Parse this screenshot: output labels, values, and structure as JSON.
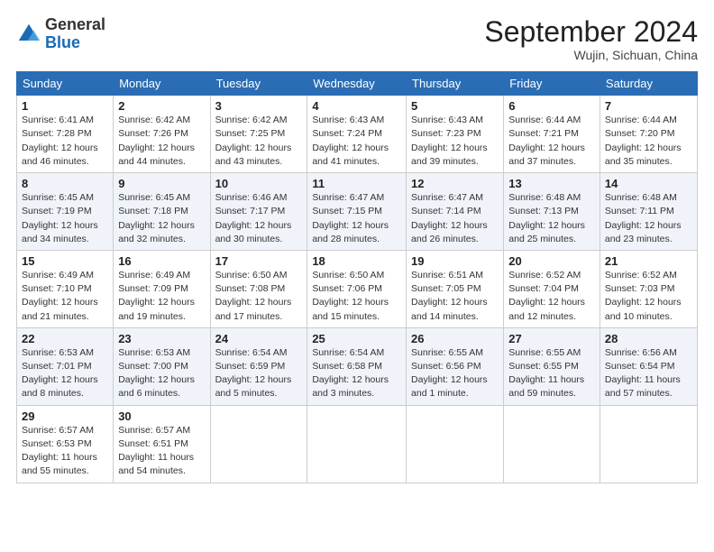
{
  "logo": {
    "general": "General",
    "blue": "Blue"
  },
  "header": {
    "month": "September 2024",
    "location": "Wujin, Sichuan, China"
  },
  "days_of_week": [
    "Sunday",
    "Monday",
    "Tuesday",
    "Wednesday",
    "Thursday",
    "Friday",
    "Saturday"
  ],
  "weeks": [
    [
      {
        "day": "1",
        "info": "Sunrise: 6:41 AM\nSunset: 7:28 PM\nDaylight: 12 hours\nand 46 minutes."
      },
      {
        "day": "2",
        "info": "Sunrise: 6:42 AM\nSunset: 7:26 PM\nDaylight: 12 hours\nand 44 minutes."
      },
      {
        "day": "3",
        "info": "Sunrise: 6:42 AM\nSunset: 7:25 PM\nDaylight: 12 hours\nand 43 minutes."
      },
      {
        "day": "4",
        "info": "Sunrise: 6:43 AM\nSunset: 7:24 PM\nDaylight: 12 hours\nand 41 minutes."
      },
      {
        "day": "5",
        "info": "Sunrise: 6:43 AM\nSunset: 7:23 PM\nDaylight: 12 hours\nand 39 minutes."
      },
      {
        "day": "6",
        "info": "Sunrise: 6:44 AM\nSunset: 7:21 PM\nDaylight: 12 hours\nand 37 minutes."
      },
      {
        "day": "7",
        "info": "Sunrise: 6:44 AM\nSunset: 7:20 PM\nDaylight: 12 hours\nand 35 minutes."
      }
    ],
    [
      {
        "day": "8",
        "info": "Sunrise: 6:45 AM\nSunset: 7:19 PM\nDaylight: 12 hours\nand 34 minutes."
      },
      {
        "day": "9",
        "info": "Sunrise: 6:45 AM\nSunset: 7:18 PM\nDaylight: 12 hours\nand 32 minutes."
      },
      {
        "day": "10",
        "info": "Sunrise: 6:46 AM\nSunset: 7:17 PM\nDaylight: 12 hours\nand 30 minutes."
      },
      {
        "day": "11",
        "info": "Sunrise: 6:47 AM\nSunset: 7:15 PM\nDaylight: 12 hours\nand 28 minutes."
      },
      {
        "day": "12",
        "info": "Sunrise: 6:47 AM\nSunset: 7:14 PM\nDaylight: 12 hours\nand 26 minutes."
      },
      {
        "day": "13",
        "info": "Sunrise: 6:48 AM\nSunset: 7:13 PM\nDaylight: 12 hours\nand 25 minutes."
      },
      {
        "day": "14",
        "info": "Sunrise: 6:48 AM\nSunset: 7:11 PM\nDaylight: 12 hours\nand 23 minutes."
      }
    ],
    [
      {
        "day": "15",
        "info": "Sunrise: 6:49 AM\nSunset: 7:10 PM\nDaylight: 12 hours\nand 21 minutes."
      },
      {
        "day": "16",
        "info": "Sunrise: 6:49 AM\nSunset: 7:09 PM\nDaylight: 12 hours\nand 19 minutes."
      },
      {
        "day": "17",
        "info": "Sunrise: 6:50 AM\nSunset: 7:08 PM\nDaylight: 12 hours\nand 17 minutes."
      },
      {
        "day": "18",
        "info": "Sunrise: 6:50 AM\nSunset: 7:06 PM\nDaylight: 12 hours\nand 15 minutes."
      },
      {
        "day": "19",
        "info": "Sunrise: 6:51 AM\nSunset: 7:05 PM\nDaylight: 12 hours\nand 14 minutes."
      },
      {
        "day": "20",
        "info": "Sunrise: 6:52 AM\nSunset: 7:04 PM\nDaylight: 12 hours\nand 12 minutes."
      },
      {
        "day": "21",
        "info": "Sunrise: 6:52 AM\nSunset: 7:03 PM\nDaylight: 12 hours\nand 10 minutes."
      }
    ],
    [
      {
        "day": "22",
        "info": "Sunrise: 6:53 AM\nSunset: 7:01 PM\nDaylight: 12 hours\nand 8 minutes."
      },
      {
        "day": "23",
        "info": "Sunrise: 6:53 AM\nSunset: 7:00 PM\nDaylight: 12 hours\nand 6 minutes."
      },
      {
        "day": "24",
        "info": "Sunrise: 6:54 AM\nSunset: 6:59 PM\nDaylight: 12 hours\nand 5 minutes."
      },
      {
        "day": "25",
        "info": "Sunrise: 6:54 AM\nSunset: 6:58 PM\nDaylight: 12 hours\nand 3 minutes."
      },
      {
        "day": "26",
        "info": "Sunrise: 6:55 AM\nSunset: 6:56 PM\nDaylight: 12 hours\nand 1 minute."
      },
      {
        "day": "27",
        "info": "Sunrise: 6:55 AM\nSunset: 6:55 PM\nDaylight: 11 hours\nand 59 minutes."
      },
      {
        "day": "28",
        "info": "Sunrise: 6:56 AM\nSunset: 6:54 PM\nDaylight: 11 hours\nand 57 minutes."
      }
    ],
    [
      {
        "day": "29",
        "info": "Sunrise: 6:57 AM\nSunset: 6:53 PM\nDaylight: 11 hours\nand 55 minutes."
      },
      {
        "day": "30",
        "info": "Sunrise: 6:57 AM\nSunset: 6:51 PM\nDaylight: 11 hours\nand 54 minutes."
      },
      {
        "day": "",
        "info": ""
      },
      {
        "day": "",
        "info": ""
      },
      {
        "day": "",
        "info": ""
      },
      {
        "day": "",
        "info": ""
      },
      {
        "day": "",
        "info": ""
      }
    ]
  ]
}
